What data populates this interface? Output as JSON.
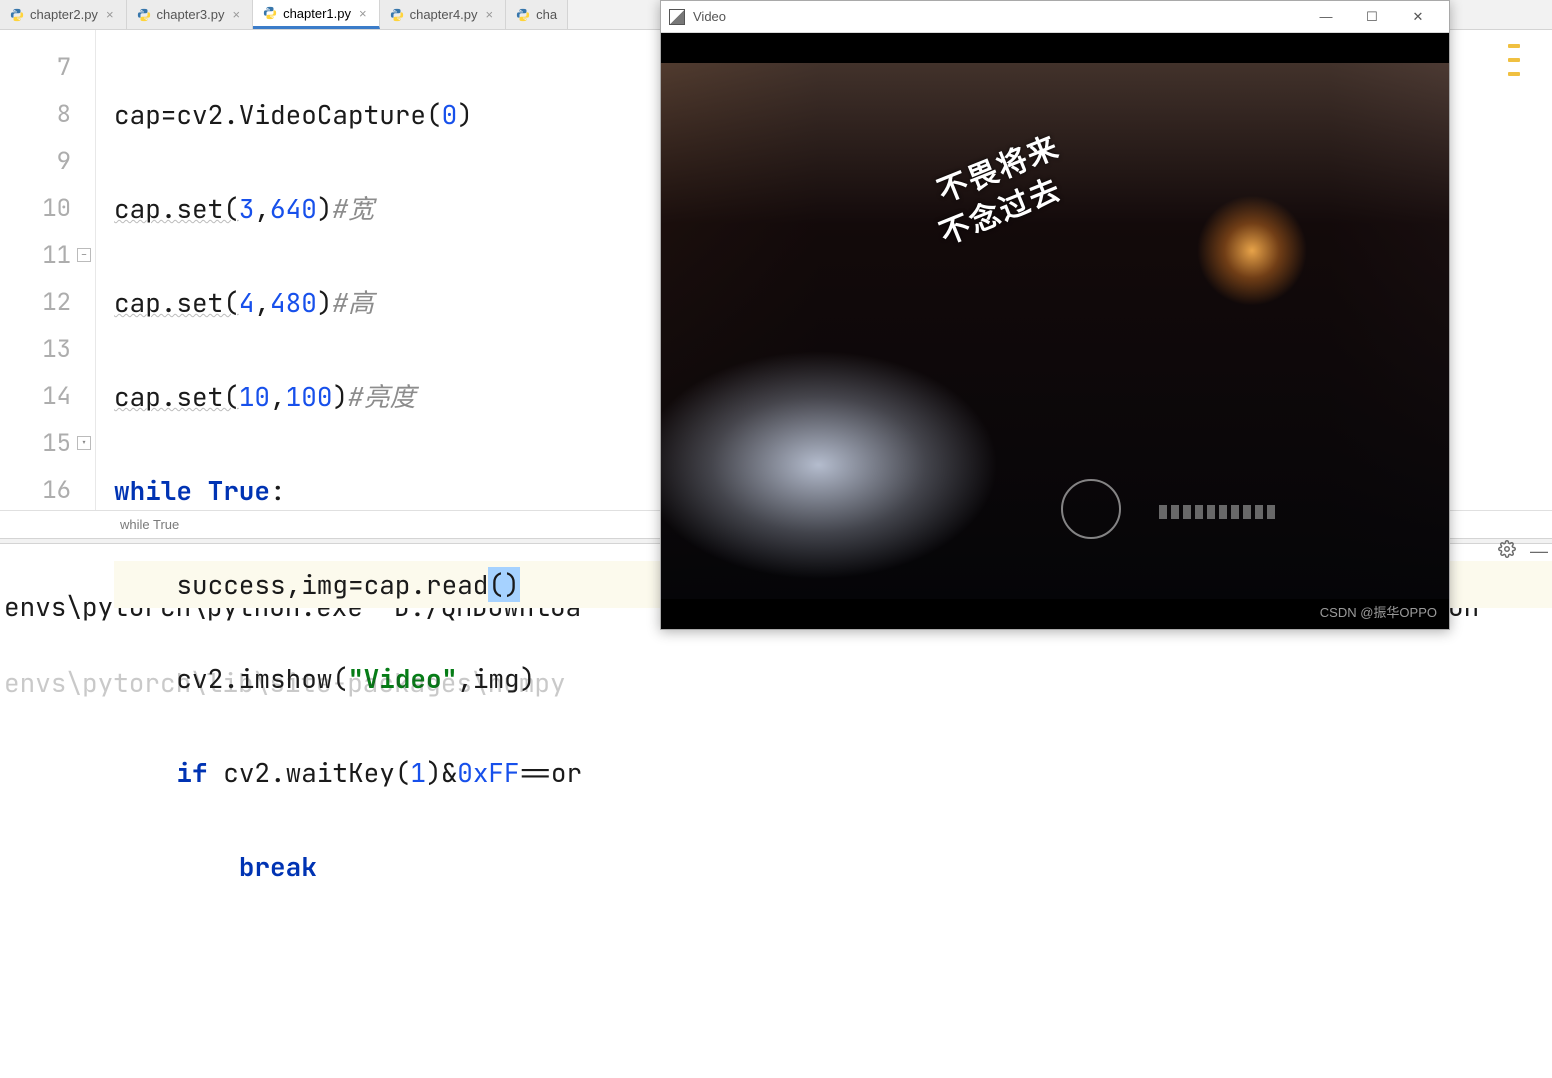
{
  "tabs": [
    {
      "label": "chapter2.py",
      "active": false
    },
    {
      "label": "chapter3.py",
      "active": false
    },
    {
      "label": "chapter1.py",
      "active": true
    },
    {
      "label": "chapter4.py",
      "active": false
    },
    {
      "label": "cha",
      "active": false
    }
  ],
  "gutter": [
    "7",
    "8",
    "9",
    "10",
    "11",
    "12",
    "13",
    "14",
    "15",
    "16"
  ],
  "code": {
    "l7": {
      "pre": "cap=cv2.VideoCapture(",
      "n1": "0",
      "post": ")"
    },
    "l8": {
      "pre": "cap.set(",
      "n1": "3",
      "c": ",",
      "n2": "640",
      "post": ")",
      "cmt": "#宽"
    },
    "l9": {
      "pre": "cap.set(",
      "n1": "4",
      "c": ",",
      "n2": "480",
      "post": ")",
      "cmt": "#高"
    },
    "l10": {
      "pre": "cap.set(",
      "n1": "10",
      "c": ",",
      "n2": "100",
      "post": ")",
      "cmt": "#亮度"
    },
    "l11": {
      "kw": "while ",
      "kw2": "True",
      "post": ":"
    },
    "l12": {
      "pre": "    success,img=cap.read",
      "sel": "()"
    },
    "l13": {
      "pre": "    cv2.imshow(",
      "str": "\"Video\"",
      "post": ",img)"
    },
    "l14": {
      "pre": "    ",
      "kw": "if ",
      "mid": "cv2.waitKey(",
      "n1": "1",
      "mid2": ")&",
      "hex": "0xFF",
      "post": "==or"
    },
    "l15": {
      "pre": "        ",
      "kw": "break"
    }
  },
  "breadcrumb": "while True",
  "console": {
    "line1": "envs\\pytorch\\python.exe \"D:/QMDownloa",
    "line1_right": "ython",
    "line2": "envs\\pytorch\\lib\\site-packages\\numpy"
  },
  "video_window": {
    "title": "Video",
    "overlay_text_1": "不畏将来",
    "overlay_text_2": "不念过去",
    "watermark": "CSDN @振华OPPO"
  }
}
